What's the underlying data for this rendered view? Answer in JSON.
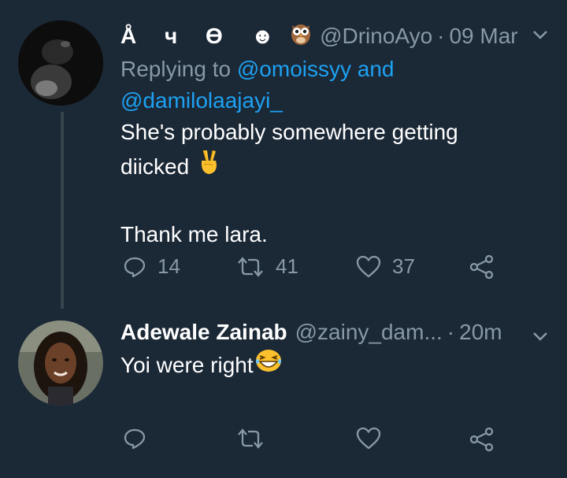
{
  "tweet1": {
    "display_name": "Å ч ϴ ☻",
    "handle": "@DrinoAyo",
    "time": "09 Mar",
    "reply_prefix": "Replying to ",
    "reply_user1": "@omoissyy",
    "reply_and": " and",
    "reply_user2": "@damilolaajayi_",
    "text_line1": "She's probably somewhere getting",
    "text_line2": "diicked",
    "text_line3": "Thank me lara.",
    "reply_count": "14",
    "retweet_count": "41",
    "like_count": "37",
    "icons": [
      "owl-emoji",
      "victory-hand-emoji",
      "reply-icon",
      "retweet-icon",
      "heart-icon",
      "share-icon",
      "chevron-down-icon"
    ]
  },
  "tweet2": {
    "display_name": "Adewale Zainab",
    "handle": "@zainy_dam...",
    "time": "20m",
    "text": "Yoi were right",
    "icons": [
      "grinning-squinting-emoji",
      "reply-icon",
      "retweet-icon",
      "heart-icon",
      "share-icon",
      "chevron-down-icon"
    ]
  },
  "colors": {
    "background": "#1b2836",
    "secondary_text": "#8899a6",
    "link": "#1da1f2",
    "thread_line": "#38444d"
  }
}
